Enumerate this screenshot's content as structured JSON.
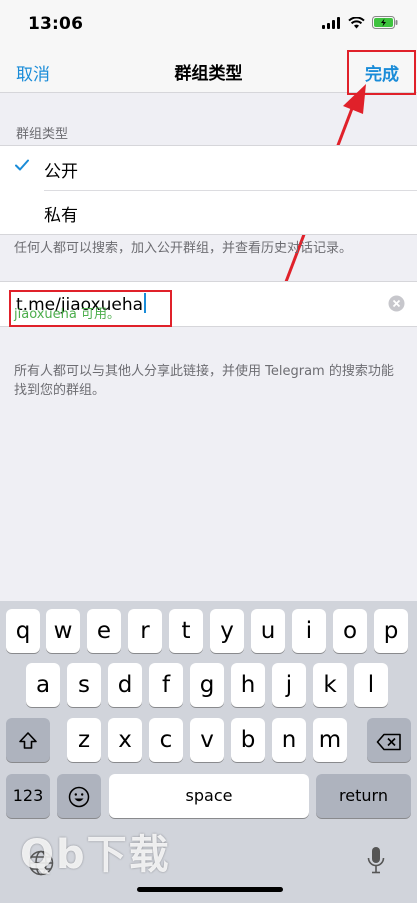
{
  "status": {
    "time": "13:06"
  },
  "nav": {
    "cancel": "取消",
    "title": "群组类型",
    "done": "完成"
  },
  "section": {
    "label": "群组类型"
  },
  "options": [
    {
      "label": "公开",
      "checked": true
    },
    {
      "label": "私有",
      "checked": false
    }
  ],
  "public_note": "任何人都可以搜索，加入公开群组，并查看历史对话记录。",
  "link": {
    "value": "t.me/jiaoxueha",
    "available": "jiaoxueha 可用。"
  },
  "share_note": "所有人都可以与其他人分享此链接，并使用 Telegram 的搜索功能找到您的群组。",
  "keyboard": {
    "row1": [
      "q",
      "w",
      "e",
      "r",
      "t",
      "y",
      "u",
      "i",
      "o",
      "p"
    ],
    "row2": [
      "a",
      "s",
      "d",
      "f",
      "g",
      "h",
      "j",
      "k",
      "l"
    ],
    "row3": [
      "z",
      "x",
      "c",
      "v",
      "b",
      "n",
      "m"
    ],
    "numbers_key": "123",
    "space_key": "space",
    "return_key": "return"
  },
  "watermark": "Qb下载",
  "colors": {
    "accent": "#1a8cd8",
    "highlight": "#e0212a",
    "available": "#4cae4c"
  }
}
